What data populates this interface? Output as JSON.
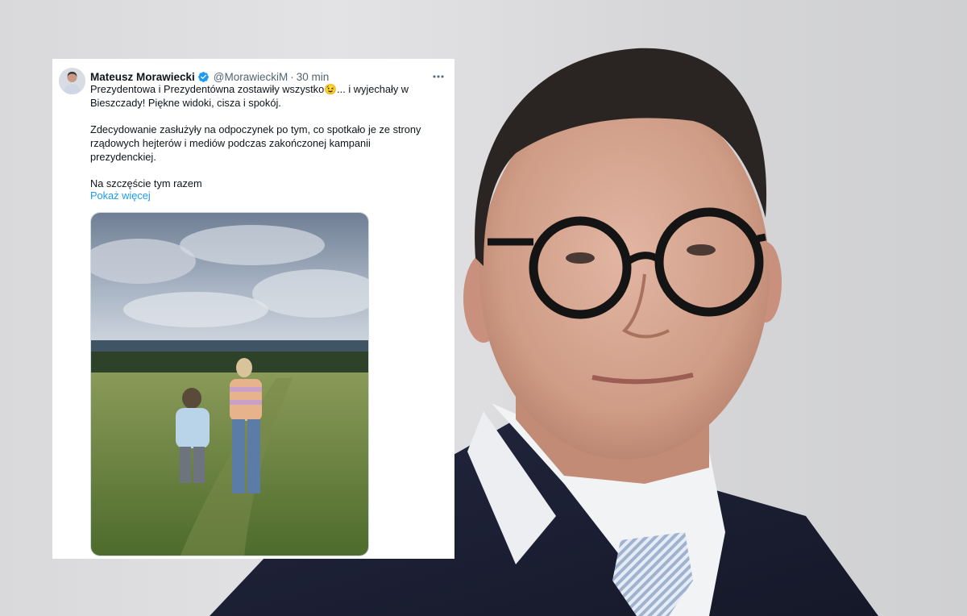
{
  "tweet": {
    "author_name": "Mateusz Morawiecki",
    "handle": "@MorawieckiM",
    "separator": "·",
    "time": "30 min",
    "paragraph_1_text": "Prezydentowa i Prezydentówna zostawiły wszystko",
    "paragraph_1_emoji": "😉",
    "paragraph_1_rest": "... i wyjechały w Bieszczady! Piękne widoki, cisza i spokój.",
    "paragraph_2": "Zdecydowanie zasłużyły na odpoczynek po tym, co spotkało je ze strony rządowych hejterów i mediów podczas zakończonej kampanii prezydenckiej.",
    "paragraph_3": "Na szczęście tym razem",
    "show_more": "Pokaż więcej"
  },
  "colors": {
    "link": "#1d9bf0",
    "verified": "#1d9bf0",
    "secondary_text": "#536471"
  },
  "icons": {
    "verified": "verified-badge-icon",
    "more": "more-horizontal-icon"
  }
}
